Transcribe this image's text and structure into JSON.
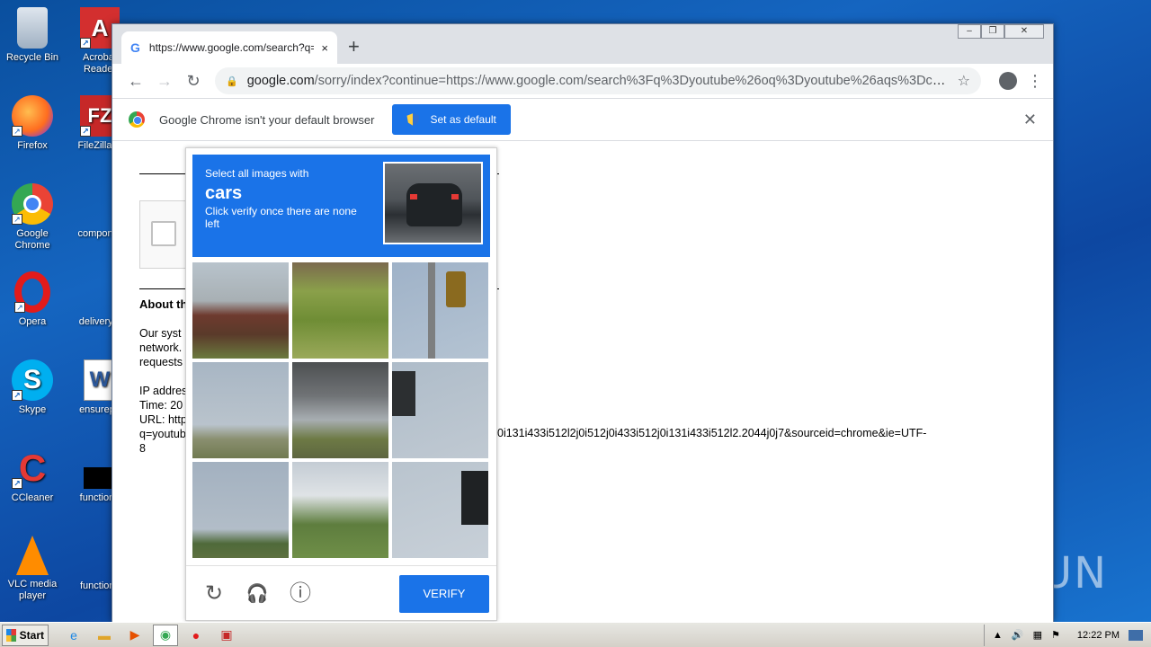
{
  "desktop": {
    "icons_col1": [
      {
        "label": "Recycle Bin",
        "glyph": "🗑"
      },
      {
        "label": "Firefox",
        "glyph": "🦊"
      },
      {
        "label": "Google Chrome",
        "glyph": "⬤"
      },
      {
        "label": "Opera",
        "glyph": "O"
      },
      {
        "label": "Skype",
        "glyph": "S"
      },
      {
        "label": "CCleaner",
        "glyph": "C"
      },
      {
        "label": "VLC media player",
        "glyph": "▲"
      }
    ],
    "icons_col2": [
      {
        "label": "Acrobat Reader",
        "glyph": "A"
      },
      {
        "label": "FileZilla C",
        "glyph": "FZ"
      },
      {
        "label": "componer",
        "glyph": ""
      },
      {
        "label": "deliveryoi",
        "glyph": ""
      },
      {
        "label": "ensurepa",
        "glyph": "W"
      },
      {
        "label": "functionp",
        "glyph": ""
      },
      {
        "label": "functions",
        "glyph": ""
      }
    ]
  },
  "browser": {
    "tab_title": "https://www.google.com/search?q=",
    "tab_favicon": "G",
    "tab_close": "×",
    "newtab": "+",
    "url_host": "google.com",
    "url_rest": "/sorry/index?continue=https://www.google.com/search%3Fq%3Dyoutube%26oq%3Dyoutube%26aqs%3Dchr...",
    "infobar_text": "Google Chrome isn't your default browser",
    "infobar_button": "Set as default",
    "infobar_close": "✕"
  },
  "page": {
    "about_heading": "About th",
    "body_lines": [
      "Our syst",
      "network.",
      "requests"
    ],
    "meta_lines": [
      "IP addres",
      "Time: 20",
      "URL: http"
    ],
    "url_lines": [
      "q=youtub",
      "8"
    ],
    "url_tail": "0i131i433i512l2j0i512j0i433i512j0i131i433i512l2.2044j0j7&sourceid=chrome&ie=UTF-"
  },
  "captcha": {
    "prompt_small": "Select all images with",
    "prompt_big": "cars",
    "prompt_instructions": "Click verify once there are none left",
    "verify_label": "VERIFY",
    "reload_icon": "↻",
    "audio_icon": "🎧",
    "info_icon": "ⓘ"
  },
  "taskbar": {
    "start_label": "Start",
    "clock": "12:22 PM"
  },
  "watermark": "ANY▷RUN"
}
